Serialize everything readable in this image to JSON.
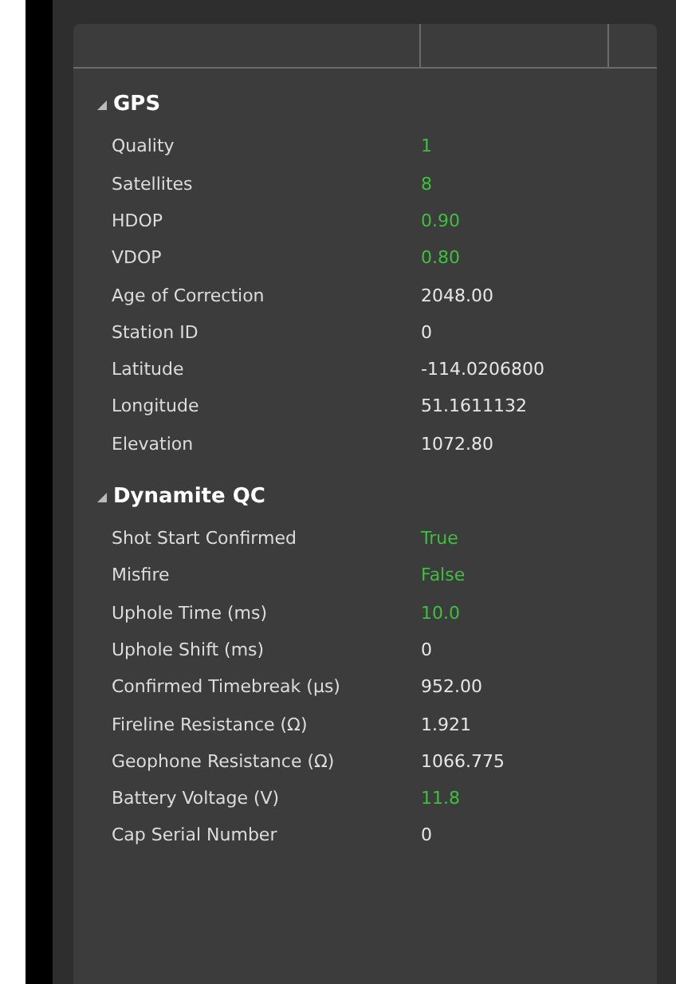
{
  "sections": [
    {
      "title": "GPS",
      "expanded": true,
      "rows": [
        {
          "label": "Quality",
          "value": "1",
          "color": "#3fbf3f"
        },
        {
          "label": "Satellites",
          "value": "8",
          "color": "#3fbf3f"
        },
        {
          "label": "HDOP",
          "value": "0.90",
          "color": "#3fbf3f"
        },
        {
          "label": "VDOP",
          "value": "0.80",
          "color": "#3fbf3f"
        },
        {
          "label": "Age of Correction",
          "value": "2048.00",
          "color": "#e6e6e6"
        },
        {
          "label": "Station ID",
          "value": "0",
          "color": "#e6e6e6"
        },
        {
          "label": "Latitude",
          "value": "-114.0206800",
          "color": "#e6e6e6"
        },
        {
          "label": "Longitude",
          "value": "51.1611132",
          "color": "#e6e6e6"
        },
        {
          "label": "Elevation",
          "value": "1072.80",
          "color": "#e6e6e6"
        }
      ]
    },
    {
      "title": "Dynamite QC",
      "expanded": true,
      "rows": [
        {
          "label": "Shot Start Confirmed",
          "value": "True",
          "color": "#3fbf3f"
        },
        {
          "label": "Misfire",
          "value": "False",
          "color": "#3fbf3f"
        },
        {
          "label": "Uphole Time (ms)",
          "value": "10.0",
          "color": "#3fbf3f"
        },
        {
          "label": "Uphole Shift (ms)",
          "value": "0",
          "color": "#e6e6e6"
        },
        {
          "label": "Confirmed Timebreak (µs)",
          "value": "952.00",
          "color": "#e6e6e6"
        },
        {
          "label": "Fireline Resistance (Ω)",
          "value": "1.921",
          "color": "#e6e6e6"
        },
        {
          "label": "Geophone Resistance (Ω)",
          "value": "1066.775",
          "color": "#e6e6e6"
        },
        {
          "label": "Battery Voltage (V)",
          "value": "11.8",
          "color": "#3fbf3f"
        },
        {
          "label": "Cap Serial Number",
          "value": "0",
          "color": "#e6e6e6"
        }
      ]
    }
  ]
}
